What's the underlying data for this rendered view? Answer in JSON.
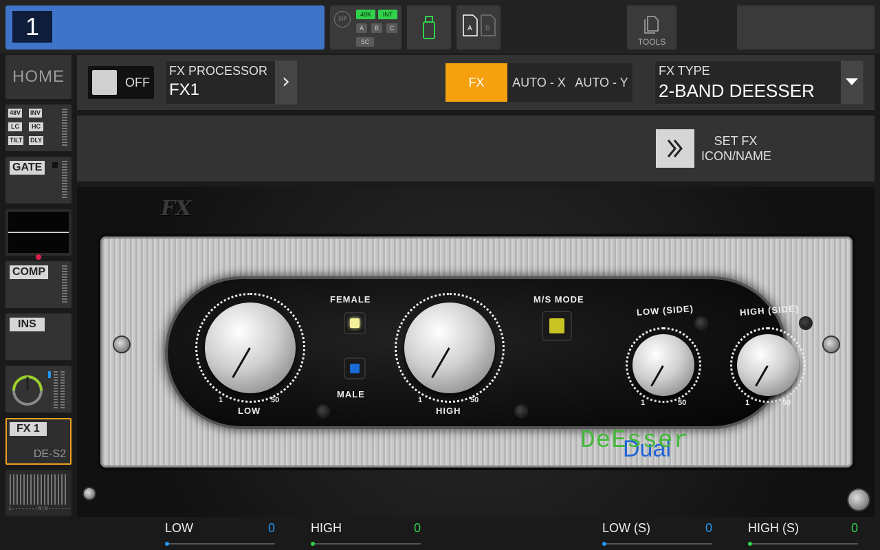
{
  "colors": {
    "accent_blue": "#3f74c9",
    "active_orange": "#f5a00f",
    "param_blue": "#2196f3",
    "param_green": "#2fd24a"
  },
  "topbar": {
    "channel_number": "1",
    "status": {
      "sip": "SIP",
      "rate": "48K",
      "clock": "INT",
      "a": "A",
      "b": "B",
      "c": "C",
      "sc": "SC"
    },
    "usb_icon": "usb-stick-icon",
    "ab_icon": "ab-card-icon",
    "tools_label": "TOOLS",
    "tools_icon": "documents-icon"
  },
  "sidebar": {
    "home": "HOME",
    "preamp_tags": [
      "48V",
      "INV",
      "LC",
      "HC",
      "TILT",
      "DLY"
    ],
    "gate": "GATE",
    "comp": "COMP",
    "ins": "INS",
    "fx_tag": "FX 1",
    "fx_sub": "DE-S2",
    "meter_scale": "1--------8|9--------16"
  },
  "header": {
    "toggle_label": "OFF",
    "fx_processor_label": "FX PROCESSOR",
    "fx_processor_value": "FX1",
    "tabs": [
      "FX",
      "AUTO - X",
      "AUTO - Y"
    ],
    "fx_type_label": "FX TYPE",
    "fx_type_value": "2-BAND DEESSER"
  },
  "set_fx": {
    "label_line1": "SET FX",
    "label_line2": "ICON/NAME"
  },
  "plugin": {
    "logo": "FX",
    "knobs": [
      {
        "label": "LOW",
        "min": "1",
        "max": "50"
      },
      {
        "label": "HIGH",
        "min": "1",
        "max": "50"
      },
      {
        "label": "LOW (SIDE)",
        "min": "1",
        "max": "50"
      },
      {
        "label": "HIGH (SIDE)",
        "min": "1",
        "max": "50"
      }
    ],
    "female_label": "FEMALE",
    "male_label": "MALE",
    "ms_mode_label": "M/S MODE",
    "brand_line1": "Dual",
    "brand_line2": "DeEsser"
  },
  "params": [
    {
      "label": "LOW",
      "value": "0",
      "color": "#2196f3"
    },
    {
      "label": "HIGH",
      "value": "0",
      "color": "#2fd24a"
    },
    {
      "label": "LOW (S)",
      "value": "0",
      "color": "#2196f3"
    },
    {
      "label": "HIGH (S)",
      "value": "0",
      "color": "#2fd24a"
    }
  ]
}
